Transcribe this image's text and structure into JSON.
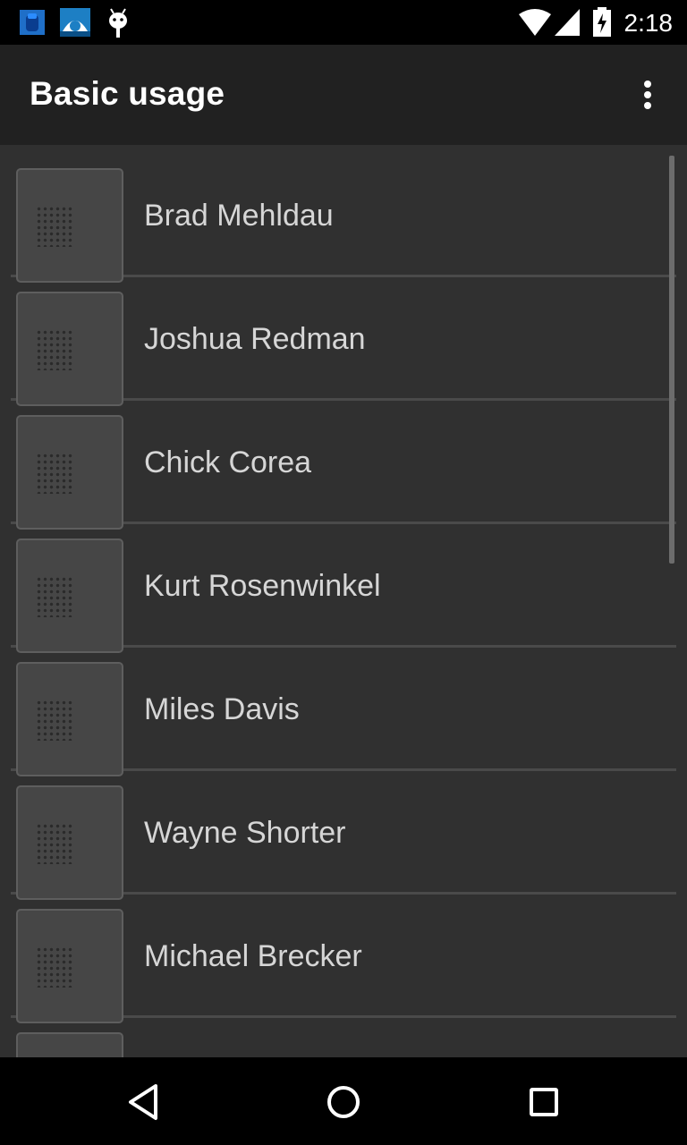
{
  "status_bar": {
    "time": "2:18",
    "left_icons": [
      "app-notification-icon",
      "weather-notification-icon",
      "android-debug-icon"
    ],
    "right_icons": [
      "wifi-icon",
      "cell-signal-icon",
      "battery-charging-icon"
    ]
  },
  "app_bar": {
    "title": "Basic usage",
    "menu_icon": "overflow-menu-icon"
  },
  "list": {
    "items": [
      {
        "label": "Brad Mehldau"
      },
      {
        "label": "Joshua Redman"
      },
      {
        "label": "Chick Corea"
      },
      {
        "label": "Kurt Rosenwinkel"
      },
      {
        "label": "Miles Davis"
      },
      {
        "label": "Wayne Shorter"
      },
      {
        "label": "Michael Brecker"
      },
      {
        "label": ""
      }
    ]
  },
  "nav_bar": {
    "buttons": [
      "back-icon",
      "home-icon",
      "recents-icon"
    ]
  },
  "colors": {
    "background": "#303030",
    "app_bar": "#212121",
    "status_bar": "#000000",
    "handle": "#464646",
    "divider": "#4a4a4a",
    "text": "#d6d6d6"
  }
}
